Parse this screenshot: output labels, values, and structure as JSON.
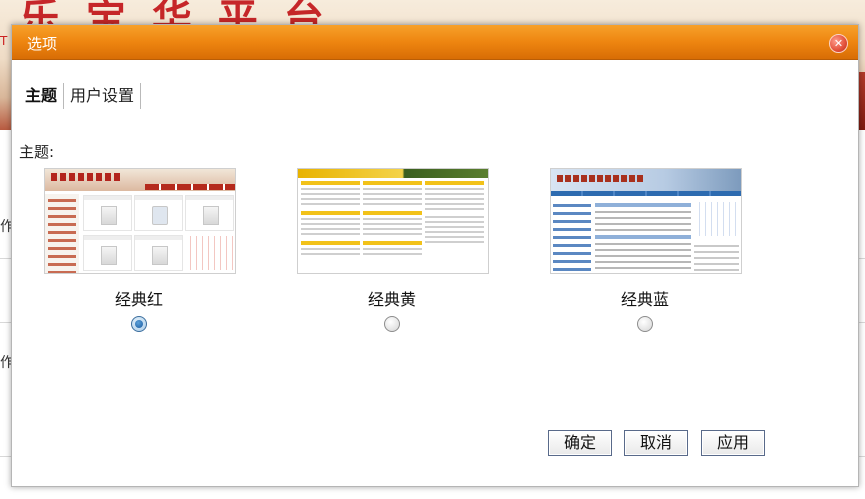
{
  "background": {
    "banner_text": "乐 宝 华 平 台",
    "side_texts": [
      "作",
      "作"
    ],
    "tail_letter": "T"
  },
  "dialog": {
    "title": "选项",
    "close_icon": "close-icon",
    "tabs": [
      {
        "label": "主题",
        "active": true
      },
      {
        "label": "用户设置",
        "active": false
      }
    ],
    "section_label": "主题:",
    "themes": [
      {
        "name": "经典红",
        "selected": true,
        "accent": "#b52a1d"
      },
      {
        "name": "经典黄",
        "selected": false,
        "accent": "#f2c21a"
      },
      {
        "name": "经典蓝",
        "selected": false,
        "accent": "#2d6bb0"
      }
    ],
    "buttons": {
      "ok": "确定",
      "cancel": "取消",
      "apply": "应用"
    }
  },
  "colors": {
    "titlebar": "#ee8510",
    "button_border": "#596a8a"
  }
}
